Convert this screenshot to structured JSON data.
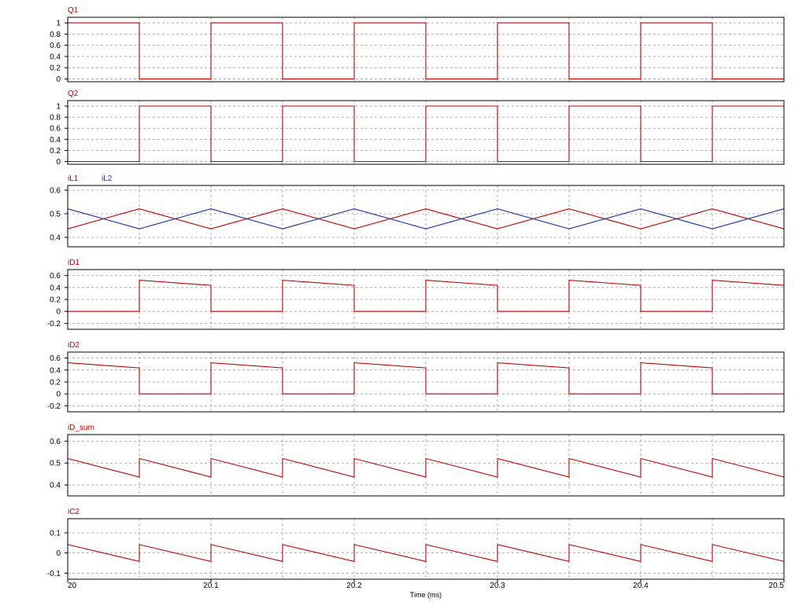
{
  "chart_data": {
    "type": "line",
    "x_axis": {
      "label": "Time (ms)",
      "range": [
        20,
        20.5
      ],
      "ticks": [
        "20",
        "20.1",
        "20.2",
        "20.3",
        "20.4",
        "20.5"
      ],
      "minor_grid_step": 0.05
    },
    "grid": true,
    "grid_style": "dashed",
    "panels": [
      {
        "id": "q1",
        "ylim": [
          -0.05,
          1.1
        ],
        "yticks": [
          {
            "v": 1,
            "label": "1"
          },
          {
            "v": 0.8,
            "label": "0.8"
          },
          {
            "v": 0.6,
            "label": "0.6"
          },
          {
            "v": 0.4,
            "label": "0.4"
          },
          {
            "v": 0.2,
            "label": "0.2"
          },
          {
            "v": 0,
            "label": "0"
          }
        ],
        "series": [
          {
            "name": "Q1",
            "color": "#c00000",
            "points": [
              [
                20,
                1
              ],
              [
                20.05,
                1
              ],
              [
                20.05,
                0
              ],
              [
                20.1,
                0
              ],
              [
                20.1,
                1
              ],
              [
                20.15,
                1
              ],
              [
                20.15,
                0
              ],
              [
                20.2,
                0
              ],
              [
                20.2,
                1
              ],
              [
                20.25,
                1
              ],
              [
                20.25,
                0
              ],
              [
                20.3,
                0
              ],
              [
                20.3,
                1
              ],
              [
                20.35,
                1
              ],
              [
                20.35,
                0
              ],
              [
                20.4,
                0
              ],
              [
                20.4,
                1
              ],
              [
                20.45,
                1
              ],
              [
                20.45,
                0
              ],
              [
                20.5,
                0
              ]
            ]
          }
        ]
      },
      {
        "id": "q2",
        "ylim": [
          -0.05,
          1.1
        ],
        "yticks": [
          {
            "v": 1,
            "label": "1"
          },
          {
            "v": 0.8,
            "label": "0.8"
          },
          {
            "v": 0.6,
            "label": "0.6"
          },
          {
            "v": 0.4,
            "label": "0.4"
          },
          {
            "v": 0.2,
            "label": "0.2"
          },
          {
            "v": 0,
            "label": "0"
          }
        ],
        "series": [
          {
            "name": "Q2",
            "color": "#c00000",
            "points": [
              [
                20,
                0
              ],
              [
                20.05,
                0
              ],
              [
                20.05,
                1
              ],
              [
                20.1,
                1
              ],
              [
                20.1,
                0
              ],
              [
                20.15,
                0
              ],
              [
                20.15,
                1
              ],
              [
                20.2,
                1
              ],
              [
                20.2,
                0
              ],
              [
                20.25,
                0
              ],
              [
                20.25,
                1
              ],
              [
                20.3,
                1
              ],
              [
                20.3,
                0
              ],
              [
                20.35,
                0
              ],
              [
                20.35,
                1
              ],
              [
                20.4,
                1
              ],
              [
                20.4,
                0
              ],
              [
                20.45,
                0
              ],
              [
                20.45,
                1
              ],
              [
                20.5,
                1
              ]
            ]
          }
        ]
      },
      {
        "id": "il",
        "ylim": [
          0.36,
          0.62
        ],
        "yticks": [
          {
            "v": 0.6,
            "label": "0.6"
          },
          {
            "v": 0.5,
            "label": "0.5"
          },
          {
            "v": 0.4,
            "label": "0.4"
          }
        ],
        "series": [
          {
            "name": "iL1",
            "color": "#c00000",
            "points": [
              [
                20,
                0.436
              ],
              [
                20.05,
                0.521
              ],
              [
                20.1,
                0.436
              ],
              [
                20.15,
                0.521
              ],
              [
                20.2,
                0.436
              ],
              [
                20.25,
                0.521
              ],
              [
                20.3,
                0.436
              ],
              [
                20.35,
                0.521
              ],
              [
                20.4,
                0.436
              ],
              [
                20.45,
                0.521
              ],
              [
                20.5,
                0.436
              ]
            ]
          },
          {
            "name": "iL2",
            "color": "#1f2f9a",
            "points": [
              [
                20,
                0.521
              ],
              [
                20.05,
                0.436
              ],
              [
                20.1,
                0.521
              ],
              [
                20.15,
                0.436
              ],
              [
                20.2,
                0.521
              ],
              [
                20.25,
                0.436
              ],
              [
                20.3,
                0.521
              ],
              [
                20.35,
                0.436
              ],
              [
                20.4,
                0.521
              ],
              [
                20.45,
                0.436
              ],
              [
                20.5,
                0.521
              ]
            ]
          }
        ]
      },
      {
        "id": "id1",
        "ylim": [
          -0.3,
          0.7
        ],
        "yticks": [
          {
            "v": 0.6,
            "label": "0.6"
          },
          {
            "v": 0.4,
            "label": "0.4"
          },
          {
            "v": 0.2,
            "label": "0.2"
          },
          {
            "v": 0,
            "label": "0"
          },
          {
            "v": -0.2,
            "label": "-0.2"
          }
        ],
        "series": [
          {
            "name": "iD1",
            "color": "#c00000",
            "points": [
              [
                20,
                0
              ],
              [
                20.05,
                0
              ],
              [
                20.05,
                0.521
              ],
              [
                20.1,
                0.436
              ],
              [
                20.1,
                0
              ],
              [
                20.15,
                0
              ],
              [
                20.15,
                0.521
              ],
              [
                20.2,
                0.436
              ],
              [
                20.2,
                0
              ],
              [
                20.25,
                0
              ],
              [
                20.25,
                0.521
              ],
              [
                20.3,
                0.436
              ],
              [
                20.3,
                0
              ],
              [
                20.35,
                0
              ],
              [
                20.35,
                0.521
              ],
              [
                20.4,
                0.436
              ],
              [
                20.4,
                0
              ],
              [
                20.45,
                0
              ],
              [
                20.45,
                0.521
              ],
              [
                20.5,
                0.436
              ]
            ]
          }
        ]
      },
      {
        "id": "id2",
        "ylim": [
          -0.3,
          0.7
        ],
        "yticks": [
          {
            "v": 0.6,
            "label": "0.6"
          },
          {
            "v": 0.4,
            "label": "0.4"
          },
          {
            "v": 0.2,
            "label": "0.2"
          },
          {
            "v": 0,
            "label": "0"
          },
          {
            "v": -0.2,
            "label": "-0.2"
          }
        ],
        "series": [
          {
            "name": "iD2",
            "color": "#c00000",
            "points": [
              [
                20,
                0.521
              ],
              [
                20.05,
                0.436
              ],
              [
                20.05,
                0
              ],
              [
                20.1,
                0
              ],
              [
                20.1,
                0.521
              ],
              [
                20.15,
                0.436
              ],
              [
                20.15,
                0
              ],
              [
                20.2,
                0
              ],
              [
                20.2,
                0.521
              ],
              [
                20.25,
                0.436
              ],
              [
                20.25,
                0
              ],
              [
                20.3,
                0
              ],
              [
                20.3,
                0.521
              ],
              [
                20.35,
                0.436
              ],
              [
                20.35,
                0
              ],
              [
                20.4,
                0
              ],
              [
                20.4,
                0.521
              ],
              [
                20.45,
                0.436
              ],
              [
                20.45,
                0
              ],
              [
                20.5,
                0
              ]
            ]
          }
        ]
      },
      {
        "id": "idsum",
        "ylim": [
          0.35,
          0.63
        ],
        "yticks": [
          {
            "v": 0.6,
            "label": "0.6"
          },
          {
            "v": 0.5,
            "label": "0.5"
          },
          {
            "v": 0.4,
            "label": "0.4"
          }
        ],
        "series": [
          {
            "name": "iD_sum",
            "color": "#c00000",
            "points": [
              [
                20,
                0.521
              ],
              [
                20.05,
                0.436
              ],
              [
                20.05,
                0.521
              ],
              [
                20.1,
                0.436
              ],
              [
                20.1,
                0.521
              ],
              [
                20.15,
                0.436
              ],
              [
                20.15,
                0.521
              ],
              [
                20.2,
                0.436
              ],
              [
                20.2,
                0.521
              ],
              [
                20.25,
                0.436
              ],
              [
                20.25,
                0.521
              ],
              [
                20.3,
                0.436
              ],
              [
                20.3,
                0.521
              ],
              [
                20.35,
                0.436
              ],
              [
                20.35,
                0.521
              ],
              [
                20.4,
                0.436
              ],
              [
                20.4,
                0.521
              ],
              [
                20.45,
                0.436
              ],
              [
                20.45,
                0.521
              ],
              [
                20.5,
                0.436
              ]
            ]
          }
        ]
      },
      {
        "id": "ic2",
        "ylim": [
          -0.13,
          0.17
        ],
        "yticks": [
          {
            "v": 0.1,
            "label": "0.1"
          },
          {
            "v": 0,
            "label": "0"
          },
          {
            "v": -0.1,
            "label": "-0.1"
          }
        ],
        "series": [
          {
            "name": "iC2",
            "color": "#c00000",
            "points": [
              [
                20,
                0.042
              ],
              [
                20.05,
                -0.042
              ],
              [
                20.05,
                0.042
              ],
              [
                20.1,
                -0.042
              ],
              [
                20.1,
                0.042
              ],
              [
                20.15,
                -0.042
              ],
              [
                20.15,
                0.042
              ],
              [
                20.2,
                -0.042
              ],
              [
                20.2,
                0.042
              ],
              [
                20.25,
                -0.042
              ],
              [
                20.25,
                0.042
              ],
              [
                20.3,
                -0.042
              ],
              [
                20.3,
                0.042
              ],
              [
                20.35,
                -0.042
              ],
              [
                20.35,
                0.042
              ],
              [
                20.4,
                -0.042
              ],
              [
                20.4,
                0.042
              ],
              [
                20.45,
                -0.042
              ],
              [
                20.45,
                0.042
              ],
              [
                20.5,
                -0.042
              ]
            ]
          }
        ]
      }
    ]
  }
}
